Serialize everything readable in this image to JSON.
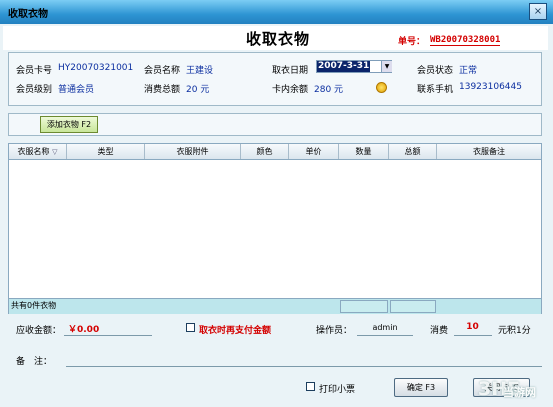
{
  "window": {
    "title": "收取衣物",
    "close_glyph": "×"
  },
  "header": {
    "title": "收取衣物",
    "order_no_label": "单号：",
    "order_no": "WB20070328001"
  },
  "member": {
    "card_label": "会员卡号",
    "card": "HY20070321001",
    "name_label": "会员名称",
    "name": "王建设",
    "date_label": "取衣日期",
    "date": "2007-3-31",
    "status_label": "会员状态",
    "status": "正常",
    "level_label": "会员级别",
    "level": "普通会员",
    "total_label": "消费总额",
    "total": "20 元",
    "balance_label": "卡内余额",
    "balance": "280 元",
    "phone_label": "联系手机",
    "phone": "13923106445"
  },
  "add_button": "添加衣物 F2",
  "grid": {
    "columns": [
      "衣服名称",
      "类型",
      "衣服附件",
      "颜色",
      "单价",
      "数量",
      "总额",
      "衣服备注"
    ],
    "rows": [],
    "footer": "共有0件衣物"
  },
  "summary": {
    "receivable_label": "应收金额：",
    "receivable": "￥0.00",
    "pay_on_pickup": "取衣时再支付金额",
    "pay_on_pickup_checked": false,
    "operator_label": "操作员：",
    "operator": "admin",
    "consume_label": "消费",
    "points": "10",
    "points_unit": "元积1分",
    "remark_label": "备　注：",
    "remark": ""
  },
  "print_receipt": {
    "label": "打印小票",
    "checked": false
  },
  "buttons": {
    "ok": "确定 F3",
    "close": "关闭 ESC"
  },
  "watermark": {
    "logo": "3HE",
    "text": "当游网"
  },
  "colors": {
    "titlebar": "#2e95d3",
    "accent_red": "#d40000",
    "value_blue": "#0c2fa0",
    "client_bg": "#eaf3f7"
  }
}
